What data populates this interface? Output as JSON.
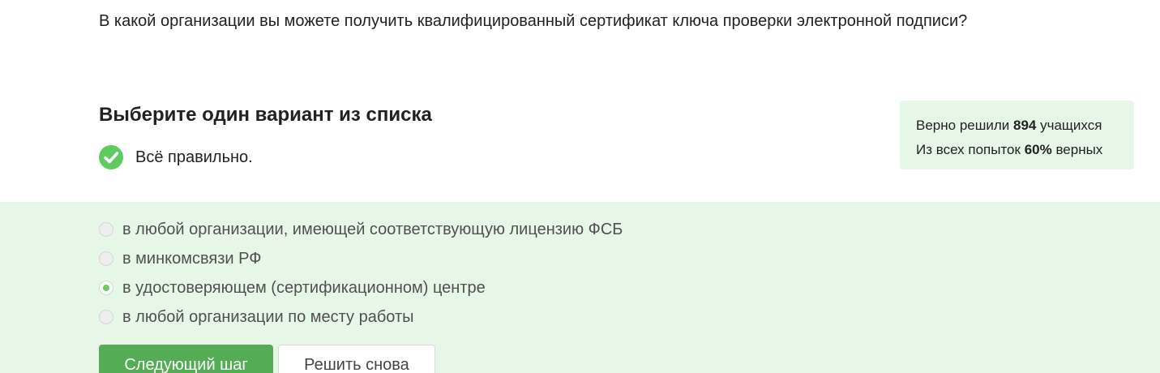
{
  "question": {
    "text": "В какой организации вы можете получить квалифицированный сертификат ключа проверки электронной подписи?"
  },
  "task": {
    "heading": "Выберите один вариант из списка",
    "result_text": "Всё правильно.",
    "result_icon": "check-circle-icon",
    "result_color": "#5fcb5f"
  },
  "stats": {
    "line1_prefix": "Верно решили ",
    "line1_value": "894",
    "line1_suffix": " учащихся",
    "line2_prefix": "Из всех попыток ",
    "line2_value": "60%",
    "line2_suffix": " верных"
  },
  "options": [
    {
      "label": "в любой организации, имеющей соответствующую лицензию ФСБ",
      "selected": false
    },
    {
      "label": "в минкомсвязи РФ",
      "selected": false
    },
    {
      "label": "в удостоверяющем (сертификационном) центре",
      "selected": true
    },
    {
      "label": "в любой организации по месту работы",
      "selected": false
    }
  ],
  "buttons": {
    "next_label": "Следующий шаг",
    "retry_label": "Решить снова"
  },
  "colors": {
    "accent_green": "#54ad54",
    "success_background": "#e6f7e8"
  }
}
